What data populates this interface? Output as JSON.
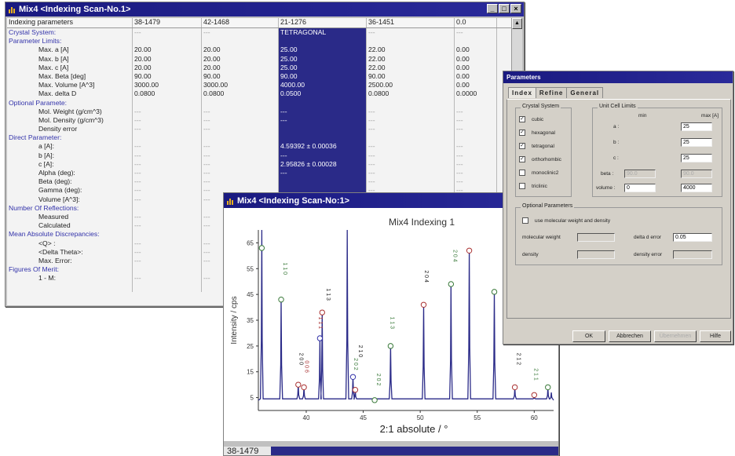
{
  "indexing_window": {
    "title": "Mix4 <Indexing Scan-No.1>",
    "headers": [
      "Indexing parameters",
      "38-1479",
      "42-1468",
      "21-1276",
      "36-1451",
      "0.0"
    ],
    "rows": [
      {
        "label": "Crystal System:",
        "section": true,
        "cells": [
          "---",
          "---",
          "TETRAGONAL",
          "---",
          "---"
        ]
      },
      {
        "label": "Parameter Limits:",
        "section": true,
        "cells": [
          "",
          "",
          "",
          "",
          ""
        ]
      },
      {
        "label": "Max. a [A]",
        "section": false,
        "cells": [
          "20.00",
          "20.00",
          "25.00",
          "22.00",
          "0.00"
        ]
      },
      {
        "label": "Max. b [A]",
        "section": false,
        "cells": [
          "20.00",
          "20.00",
          "25.00",
          "22.00",
          "0.00"
        ]
      },
      {
        "label": "Max. c [A]",
        "section": false,
        "cells": [
          "20.00",
          "20.00",
          "25.00",
          "22.00",
          "0.00"
        ]
      },
      {
        "label": "Max. Beta [deg]",
        "section": false,
        "cells": [
          "90.00",
          "90.00",
          "90.00",
          "90.00",
          "0.00"
        ]
      },
      {
        "label": "Max. Volume [A^3]",
        "section": false,
        "cells": [
          "3000.00",
          "3000.00",
          "4000.00",
          "2500.00",
          "0.00"
        ]
      },
      {
        "label": "Max. delta D",
        "section": false,
        "cells": [
          "0.0800",
          "0.0800",
          "0.0500",
          "0.0800",
          "0.0000"
        ]
      },
      {
        "label": "Optional Paramete:",
        "section": true,
        "cells": [
          "",
          "",
          "",
          "",
          ""
        ]
      },
      {
        "label": "Mol. Weight (g/cm^3)",
        "section": false,
        "cells": [
          "---",
          "---",
          "---",
          "---",
          "---"
        ]
      },
      {
        "label": "Mol. Density (g/cm^3)",
        "section": false,
        "cells": [
          "---",
          "---",
          "---",
          "---",
          "---"
        ]
      },
      {
        "label": "Density error",
        "section": false,
        "cells": [
          "---",
          "---",
          "",
          "---",
          "---"
        ]
      },
      {
        "label": "Direct Parameter:",
        "section": true,
        "cells": [
          "",
          "",
          "",
          "",
          ""
        ]
      },
      {
        "label": "a [A]:",
        "section": false,
        "cells": [
          "---",
          "---",
          "4.59392 ± 0.00036",
          "---",
          "---"
        ]
      },
      {
        "label": "b [A]:",
        "section": false,
        "cells": [
          "---",
          "---",
          "---",
          "---",
          "---"
        ]
      },
      {
        "label": "c [A]:",
        "section": false,
        "cells": [
          "---",
          "---",
          "2.95826 ± 0.00028",
          "---",
          "---"
        ]
      },
      {
        "label": "Alpha (deg):",
        "section": false,
        "cells": [
          "---",
          "---",
          "---",
          "---",
          "---"
        ]
      },
      {
        "label": "Beta (deg):",
        "section": false,
        "cells": [
          "---",
          "---",
          "",
          "---",
          "---"
        ]
      },
      {
        "label": "Gamma (deg):",
        "section": false,
        "cells": [
          "---",
          "---",
          "",
          "---",
          "---"
        ]
      },
      {
        "label": "Volume [A^3]:",
        "section": false,
        "cells": [
          "---",
          "---",
          "",
          "---",
          "---"
        ]
      },
      {
        "label": "Number Of Reflections:",
        "section": true,
        "cells": [
          "",
          "",
          "",
          "",
          ""
        ]
      },
      {
        "label": "Measured",
        "section": false,
        "cells": [
          "---",
          "---",
          "",
          "---",
          "---"
        ]
      },
      {
        "label": "Calculated",
        "section": false,
        "cells": [
          "---",
          "---",
          "",
          "---",
          "---"
        ]
      },
      {
        "label": "Mean Absolute Discrepancies:",
        "section": true,
        "cells": [
          "",
          "",
          "",
          "",
          ""
        ]
      },
      {
        "label": "<Q> :",
        "section": false,
        "cells": [
          "---",
          "---",
          "",
          "---",
          "---"
        ]
      },
      {
        "label": "<Delta Theta>:",
        "section": false,
        "cells": [
          "---",
          "---",
          "",
          "---",
          "---"
        ]
      },
      {
        "label": "Max. Error:",
        "section": false,
        "cells": [
          "---",
          "---",
          "",
          "---",
          "---"
        ]
      },
      {
        "label": "Figures Of Merit:",
        "section": true,
        "cells": [
          "",
          "",
          "",
          "",
          ""
        ]
      },
      {
        "label": "1 - M:",
        "section": false,
        "cells": [
          "---",
          "---",
          "",
          "---",
          "---"
        ]
      },
      {
        "label": "",
        "section": false,
        "cells": [
          "",
          "",
          "",
          "",
          ""
        ]
      }
    ]
  },
  "plot_window": {
    "title": "Mix4 <Indexing Scan-No:1>",
    "bottom_tab": "38-1479"
  },
  "chart_data": {
    "type": "line",
    "title": "Mix4 Indexing 1",
    "xlabel": "2:1 absolute / °",
    "ylabel": "Intensity / cps",
    "xlim": [
      35.8,
      61.7
    ],
    "ylim": [
      0,
      70
    ],
    "x_ticks": [
      40,
      45,
      50,
      55,
      60
    ],
    "y_ticks": [
      5,
      15,
      25,
      35,
      45,
      55,
      65
    ],
    "peaks": [
      {
        "x": 36.1,
        "y": 70
      },
      {
        "x": 37.8,
        "y": 43
      },
      {
        "x": 39.3,
        "y": 10
      },
      {
        "x": 39.8,
        "y": 9
      },
      {
        "x": 41.2,
        "y": 28
      },
      {
        "x": 41.4,
        "y": 38
      },
      {
        "x": 43.6,
        "y": 70
      },
      {
        "x": 44.1,
        "y": 13
      },
      {
        "x": 44.3,
        "y": 8
      },
      {
        "x": 46.0,
        "y": 4
      },
      {
        "x": 47.4,
        "y": 25
      },
      {
        "x": 50.3,
        "y": 41
      },
      {
        "x": 52.7,
        "y": 49
      },
      {
        "x": 54.3,
        "y": 62
      },
      {
        "x": 56.5,
        "y": 46
      },
      {
        "x": 58.3,
        "y": 9
      },
      {
        "x": 60.0,
        "y": 6
      },
      {
        "x": 61.2,
        "y": 9
      },
      {
        "x": 61.5,
        "y": 7
      }
    ],
    "markers": [
      {
        "x": 36.1,
        "y": 63,
        "color": "#3a7a3a"
      },
      {
        "x": 37.8,
        "y": 43,
        "color": "#3a7a3a"
      },
      {
        "x": 39.3,
        "y": 10,
        "color": "#aa3333"
      },
      {
        "x": 39.8,
        "y": 9,
        "color": "#aa3333"
      },
      {
        "x": 41.2,
        "y": 28,
        "color": "#3333aa"
      },
      {
        "x": 41.4,
        "y": 38,
        "color": "#aa3333"
      },
      {
        "x": 44.1,
        "y": 13,
        "color": "#3333aa"
      },
      {
        "x": 44.3,
        "y": 8,
        "color": "#aa3333"
      },
      {
        "x": 46.0,
        "y": 4,
        "color": "#3a7a3a"
      },
      {
        "x": 47.4,
        "y": 25,
        "color": "#3a7a3a"
      },
      {
        "x": 50.3,
        "y": 41,
        "color": "#aa3333"
      },
      {
        "x": 52.7,
        "y": 49,
        "color": "#3a7a3a"
      },
      {
        "x": 54.3,
        "y": 62,
        "color": "#aa3333"
      },
      {
        "x": 56.5,
        "y": 46,
        "color": "#3a7a3a"
      },
      {
        "x": 58.3,
        "y": 9,
        "color": "#aa3333"
      },
      {
        "x": 60.0,
        "y": 6,
        "color": "#aa3333"
      },
      {
        "x": 61.2,
        "y": 9,
        "color": "#3a7a3a"
      }
    ],
    "annotations": [
      {
        "text": "1 1 0",
        "x": 38.0,
        "y": 55,
        "color": "#3a7a3a"
      },
      {
        "text": "1 1 3",
        "x": 41.8,
        "y": 45,
        "color": "#222222"
      },
      {
        "text": "1 1 1",
        "x": 41.1,
        "y": 34,
        "color": "#aa3333"
      },
      {
        "text": "2 0 0",
        "x": 39.4,
        "y": 20,
        "color": "#222222"
      },
      {
        "text": "0 0 6",
        "x": 39.9,
        "y": 17,
        "color": "#aa3333"
      },
      {
        "text": "2 1 0",
        "x": 44.6,
        "y": 23,
        "color": "#222222"
      },
      {
        "text": "2 0 2",
        "x": 44.2,
        "y": 18,
        "color": "#3a7a3a"
      },
      {
        "text": "2 0 2",
        "x": 46.2,
        "y": 12,
        "color": "#3a7a3a"
      },
      {
        "text": "1 1 3",
        "x": 47.4,
        "y": 34,
        "color": "#3a7a3a"
      },
      {
        "text": "2 0 4",
        "x": 50.4,
        "y": 52,
        "color": "#222222"
      },
      {
        "text": "2 0 4",
        "x": 52.9,
        "y": 60,
        "color": "#3a7a3a"
      },
      {
        "text": "2 1 2",
        "x": 58.5,
        "y": 20,
        "color": "#222222"
      },
      {
        "text": "2 1 1",
        "x": 60.0,
        "y": 14,
        "color": "#3a7a3a"
      }
    ]
  },
  "params_dialog": {
    "title": "Parameters",
    "tabs": [
      "Index",
      "Refine",
      "General"
    ],
    "crystal_group": "Crystal System",
    "crystal_systems": [
      {
        "label": "cubic",
        "checked": true
      },
      {
        "label": "hexagonal",
        "checked": true
      },
      {
        "label": "tetragonal",
        "checked": true
      },
      {
        "label": "orthorhombic",
        "checked": true
      },
      {
        "label": "monoclinic2",
        "checked": false
      },
      {
        "label": "triclinic",
        "checked": false
      }
    ],
    "check_mark": "✓",
    "unit_cell_group": "Unit Cell Limits",
    "min_label": "min",
    "max_label": "max [A]",
    "a_label": "a :",
    "b_label": "b :",
    "c_label": "c :",
    "beta_label": "beta :",
    "volume_label": "volume :",
    "a_max": "25",
    "b_max": "25",
    "c_max": "25",
    "beta_min": "90.0",
    "beta_max": "90.0",
    "volume_min": "0",
    "volume_max": "4000",
    "optional_group": "Optional Parameters",
    "use_mw_label": "use molecular weight and density",
    "mw_label": "molecular weight",
    "delta_d_label": "delta d error",
    "delta_d_value": "0.05",
    "density_label": "density",
    "density_error_label": "density error",
    "buttons": {
      "ok": "OK",
      "cancel": "Abbrechen",
      "apply": "Übernehmen",
      "help": "Hilfe"
    }
  }
}
